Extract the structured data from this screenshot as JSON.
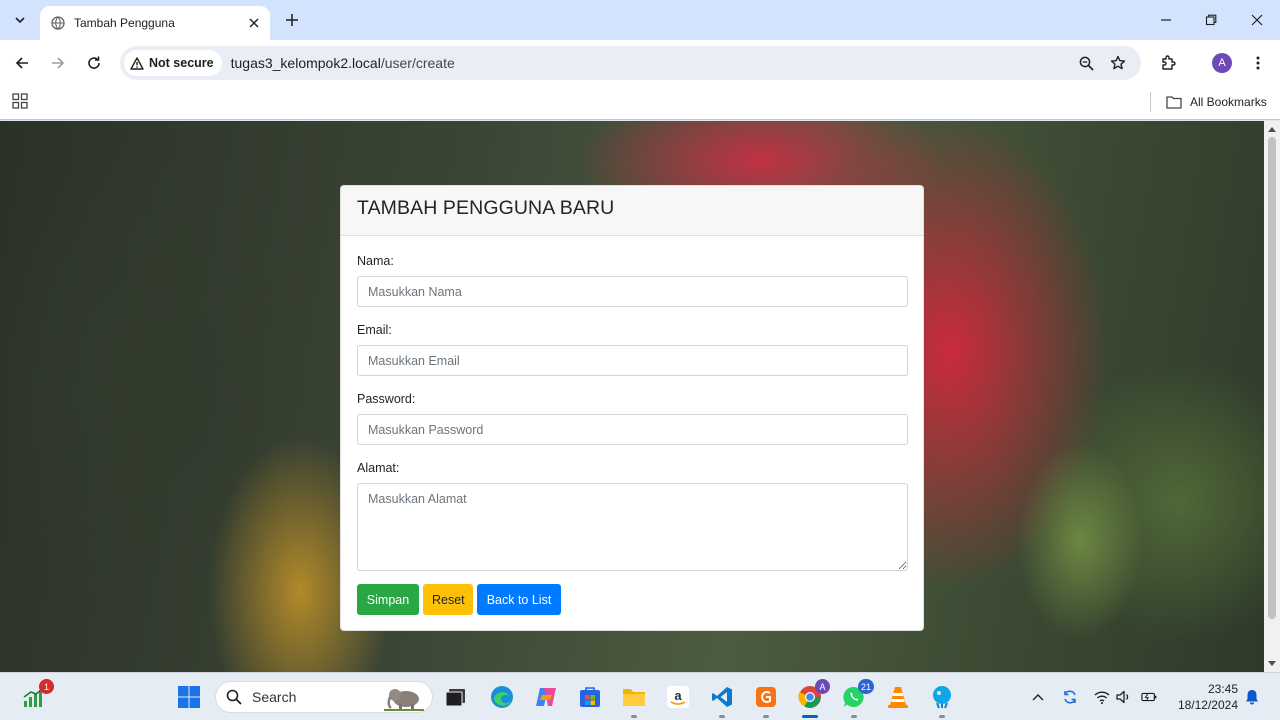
{
  "browser": {
    "tab": {
      "title": "Tambah Pengguna"
    },
    "security_label": "Not secure",
    "url_host": "tugas3_kelompok2.local",
    "url_path": "/user/create",
    "profile_initial": "A",
    "bookmarks_label": "All Bookmarks"
  },
  "form": {
    "title": "TAMBAH PENGGUNA BARU",
    "nama": {
      "label": "Nama:",
      "placeholder": "Masukkan Nama"
    },
    "email": {
      "label": "Email:",
      "placeholder": "Masukkan Email"
    },
    "password": {
      "label": "Password:",
      "placeholder": "Masukkan Password"
    },
    "alamat": {
      "label": "Alamat:",
      "placeholder": "Masukkan Alamat"
    },
    "buttons": {
      "simpan": "Simpan",
      "reset": "Reset",
      "back": "Back to List"
    },
    "colors": {
      "simpan": "#28a745",
      "reset": "#ffc107",
      "back": "#007bff"
    }
  },
  "taskbar": {
    "search_label": "Search",
    "stocks_badge": "1",
    "whatsapp_badge": "21",
    "time": "23:45",
    "date": "18/12/2024"
  }
}
